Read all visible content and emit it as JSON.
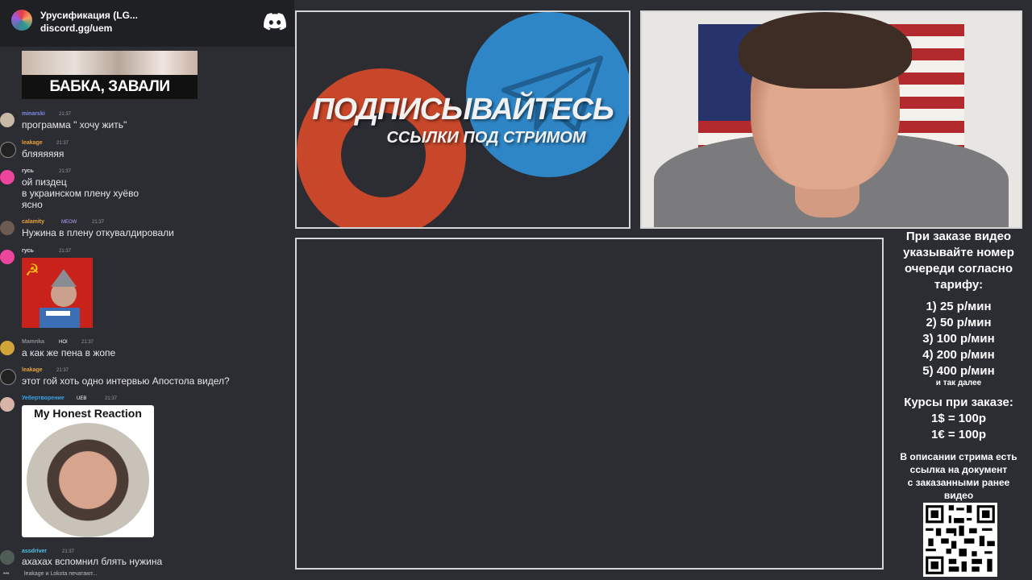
{
  "discord": {
    "server_name": "Урусификация (LG...",
    "invite": "discord.gg/uem",
    "meme_top_caption": "БАБКА, ЗАВАЛИ ЕБАЛО",
    "messages": [
      {
        "user": "minarski",
        "time": "21:37",
        "lines": [
          "программа \" хочу жить\""
        ]
      },
      {
        "user": "leakage",
        "time": "21:37",
        "lines": [
          "бляяяяяя"
        ]
      },
      {
        "user": "гусь",
        "time": "21:37",
        "lines": [
          "ой пиздец",
          "в украинском плену хуёво",
          "ясно"
        ]
      },
      {
        "user": "calamity",
        "badge": "MEOW",
        "time": "21:37",
        "lines": [
          "Нужина в плену откувалдировали"
        ]
      },
      {
        "user": "гусь",
        "time": "21:37",
        "lines": []
      },
      {
        "user": "Mamnka",
        "badge": "HOI",
        "time": "21:37",
        "lines": [
          "а как же пена в жопе"
        ]
      },
      {
        "user": "leakage",
        "time": "21:37",
        "lines": [
          "этот гой хоть одно интервью Апостола видел?"
        ]
      },
      {
        "user": "Уебертворение",
        "badge": "UEB",
        "time": "21:37",
        "lines": []
      },
      {
        "user": "assdriver",
        "time": "21:37",
        "lines": [
          "ахахах вспомнил блять нужина"
        ]
      }
    ],
    "honest_reaction_title": "My Honest Reaction",
    "typing_indicator": "leakage и Lokota печатают..."
  },
  "promo": {
    "title": "ПОДПИСЫВАЙТЕСЬ",
    "subtitle": "ССЫЛКИ ПОД СТРИМОМ"
  },
  "info": {
    "heading": [
      "При заказе видео",
      "указывайте номер",
      "очереди согласно",
      "тарифу:"
    ],
    "tariffs": [
      "1) 25 р/мин",
      "2) 50 р/мин",
      "3) 100 р/мин",
      "4) 200 р/мин",
      "5) 400 р/мин"
    ],
    "etc": "и так далее",
    "rates_title": "Курсы при заказе:",
    "rates": [
      "1$ = 100р",
      "1€ = 100р"
    ],
    "doc_note": [
      "В описании стрима есть",
      "ссылка на документ",
      "с заказанными ранее",
      "видео"
    ]
  },
  "colors": {
    "background": "#2b2d33",
    "discord_header": "#1f2024",
    "telegram_blue": "#2f86c6",
    "patreon_red": "#c8472a"
  }
}
